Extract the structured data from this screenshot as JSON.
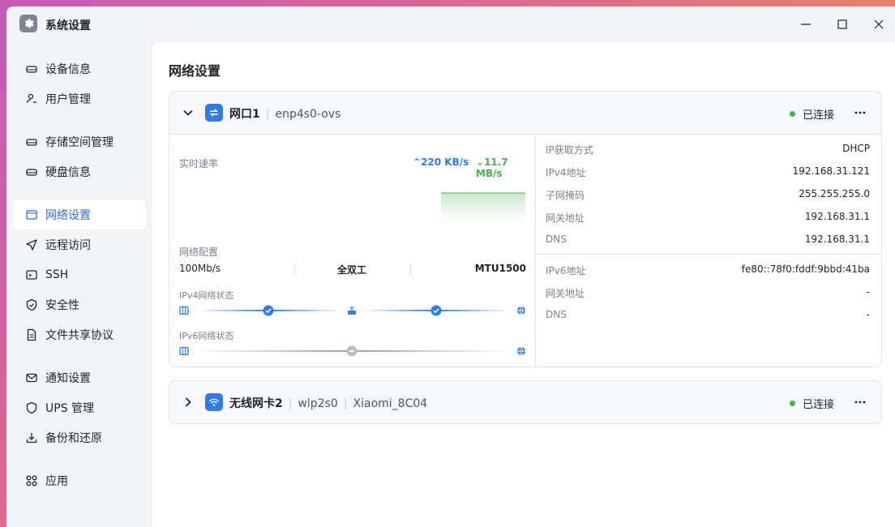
{
  "window": {
    "title": "系统设置"
  },
  "sidebar": {
    "items": [
      {
        "label": "设备信息",
        "icon": "drive-icon"
      },
      {
        "label": "用户管理",
        "icon": "user-icon"
      },
      {
        "label": "存储空间管理",
        "icon": "storage-icon"
      },
      {
        "label": "硬盘信息",
        "icon": "disk-icon"
      },
      {
        "label": "网络设置",
        "icon": "network-icon",
        "active": true
      },
      {
        "label": "远程访问",
        "icon": "send-icon"
      },
      {
        "label": "SSH",
        "icon": "terminal-icon"
      },
      {
        "label": "安全性",
        "icon": "shield-icon"
      },
      {
        "label": "文件共享协议",
        "icon": "file-icon"
      },
      {
        "label": "通知设置",
        "icon": "mail-icon"
      },
      {
        "label": "UPS 管理",
        "icon": "power-icon"
      },
      {
        "label": "备份和还原",
        "icon": "backup-icon"
      },
      {
        "label": "应用",
        "icon": "apps-icon"
      }
    ]
  },
  "main": {
    "title": "网络设置"
  },
  "iface1": {
    "name": "网口1",
    "device": "enp4s0-ovs",
    "status": "已连接",
    "speed_label": "实时速率",
    "up": "220 KB/s",
    "down": "11.7 MB/s",
    "config_label": "网络配置",
    "link_speed": "100Mb/s",
    "duplex": "全双工",
    "mtu": "MTU1500",
    "ipv4_state_label": "IPv4网络状态",
    "ipv6_state_label": "IPv6网络状态",
    "ipv4": [
      {
        "key": "IP获取方式",
        "value": "DHCP"
      },
      {
        "key": "IPv4地址",
        "value": "192.168.31.121"
      },
      {
        "key": "子网掩码",
        "value": "255.255.255.0"
      },
      {
        "key": "网关地址",
        "value": "192.168.31.1"
      },
      {
        "key": "DNS",
        "value": "192.168.31.1"
      }
    ],
    "ipv6": [
      {
        "key": "IPv6地址",
        "value": "fe80::78f0:fddf:9bbd:41ba"
      },
      {
        "key": "网关地址",
        "value": "-"
      },
      {
        "key": "DNS",
        "value": "-"
      }
    ]
  },
  "iface2": {
    "name": "无线网卡2",
    "device": "wlp2s0",
    "ssid": "Xiaomi_8C04",
    "status": "已连接"
  },
  "colors": {
    "accent": "#2f7be8",
    "connected": "#3fb34f"
  }
}
